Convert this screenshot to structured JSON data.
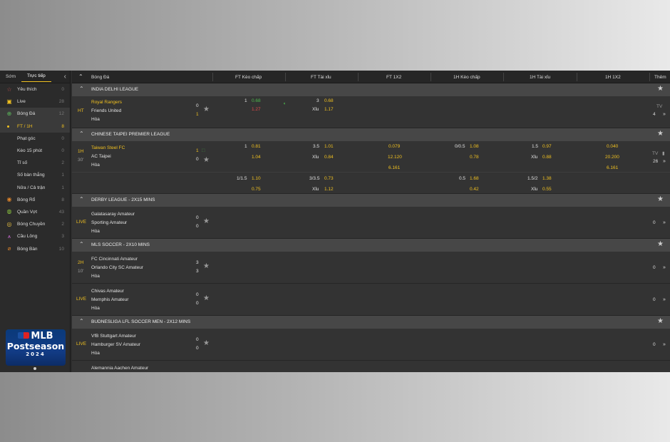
{
  "sidebar": {
    "tabs": [
      "Sớm",
      "Trực tiếp"
    ],
    "items": [
      {
        "icon": "star-icon",
        "label": "Yêu thích",
        "count": "0"
      },
      {
        "icon": "live-tv-icon",
        "label": "Live",
        "count": "28"
      },
      {
        "icon": "soccer-ball-icon",
        "label": "Bóng Đá",
        "count": "12"
      },
      {
        "label": "FT / 1H",
        "count": "8"
      },
      {
        "label": "Phạt góc",
        "count": "0"
      },
      {
        "label": "Kèo 15 phút",
        "count": "0"
      },
      {
        "label": "Tỉ số",
        "count": "2"
      },
      {
        "label": "Số bàn thắng",
        "count": "1"
      },
      {
        "label": "Nửa / Cả trận",
        "count": "1"
      },
      {
        "icon": "basketball-icon",
        "label": "Bóng Rổ",
        "count": "8"
      },
      {
        "icon": "tennis-ball-icon",
        "label": "Quần Vợt",
        "count": "43"
      },
      {
        "icon": "volleyball-icon",
        "label": "Bóng Chuyền",
        "count": "2"
      },
      {
        "icon": "shuttlecock-icon",
        "label": "Cầu Lông",
        "count": "3"
      },
      {
        "icon": "ping-pong-icon",
        "label": "Bóng Bàn",
        "count": "10"
      }
    ],
    "banner": {
      "mlb": "MLB",
      "line2": "Postseason",
      "year": "2024"
    }
  },
  "headers": {
    "sport": "Bóng Đá",
    "ft_hdp": "FT Kèo chấp",
    "ft_ou": "FT Tài xỉu",
    "ft_1x2": "FT 1X2",
    "h1_hdp": "1H Kèo chấp",
    "h1_ou": "1H Tài xỉu",
    "h1_1x2": "1H 1X2",
    "more": "Thêm"
  },
  "leagues": [
    {
      "name": "INDIA DELHI LEAGUE",
      "matches": [
        {
          "status": "HT",
          "minute": "",
          "home": "Royal Rangers",
          "away": "Friends United",
          "draw": "Hòa",
          "score_home": "0",
          "score_away": "1",
          "ft_hdp": {
            "line_home": "1",
            "odd_home": "0.68",
            "odd_away": "1.27"
          },
          "ft_ou": {
            "line": "3",
            "odd_over": "0.68",
            "under_label": "Xỉu",
            "odd_under": "1.17"
          },
          "tv": "TV",
          "more": "4"
        }
      ]
    },
    {
      "name": "CHINESE TAIPEI PREMIER LEAGUE",
      "matches": [
        {
          "status": "1H",
          "minute": "30'",
          "home": "Taiwan Steel FC",
          "away": "AC Taipei",
          "draw": "Hòa",
          "score_home": "1",
          "score_away": "0",
          "ft_hdp": {
            "line_home": "1",
            "odd_home": "0.81",
            "odd_away": "1.04"
          },
          "ft_ou": {
            "line": "3.5",
            "odd_over": "1.01",
            "under_label": "Xỉu",
            "odd_under": "0.84"
          },
          "ft_1x2": [
            "0.079",
            "12.120",
            "6.161"
          ],
          "h1_hdp": {
            "line_home": "0/0.5",
            "odd_home": "1.08",
            "odd_away": "0.78"
          },
          "h1_ou": {
            "line": "1.5",
            "odd_over": "0.97",
            "under_label": "Xỉu",
            "odd_under": "0.88"
          },
          "h1_1x2": [
            "0.040",
            "20.200",
            "6.161"
          ],
          "tv": "TV",
          "more": "26",
          "extra": {
            "ft_hdp": {
              "line": "1/1.5",
              "odd_home": "1.10",
              "odd_away": "0.75"
            },
            "ft_ou": {
              "line": "3/3.5",
              "odd_over": "0.73",
              "under_label": "Xỉu",
              "odd_under": "1.12"
            },
            "h1_hdp": {
              "line": "0.5",
              "odd_home": "1.68",
              "odd_away": "0.42"
            },
            "h1_ou": {
              "line": "1.5/2",
              "odd_over": "1.38",
              "under_label": "Xỉu",
              "odd_under": "0.55"
            }
          }
        }
      ]
    },
    {
      "name": "DERBY LEAGUE - 2X15 MINS",
      "matches": [
        {
          "status": "LIVE",
          "home": "Galatasaray Amateur",
          "away": "Sporting Amateur",
          "draw": "Hòa",
          "score_home": "0",
          "score_away": "0",
          "more": "0"
        }
      ]
    },
    {
      "name": "MLS SOCCER - 2X10 MINS",
      "matches": [
        {
          "status": "2H",
          "minute": "10'",
          "home": "FC Cincinnati Amateur",
          "away": "Orlando City SC Amateur",
          "draw": "Hòa",
          "score_home": "3",
          "score_away": "3",
          "more": "0"
        },
        {
          "status": "LIVE",
          "home": "Chivas Amateur",
          "away": "Memphis Amateur",
          "draw": "Hòa",
          "score_home": "0",
          "score_away": "0",
          "more": "0"
        }
      ]
    },
    {
      "name": "BUDNESLIGA LFL SOCCER MEN - 2X12 MINS",
      "matches": [
        {
          "status": "LIVE",
          "home": "VfB Stuttgart Amateur",
          "away": "Hamburger SV Amateur",
          "draw": "Hòa",
          "score_home": "0",
          "score_away": "0",
          "more": "0"
        },
        {
          "home": "Alemannia Aachen Amateur"
        }
      ]
    }
  ]
}
